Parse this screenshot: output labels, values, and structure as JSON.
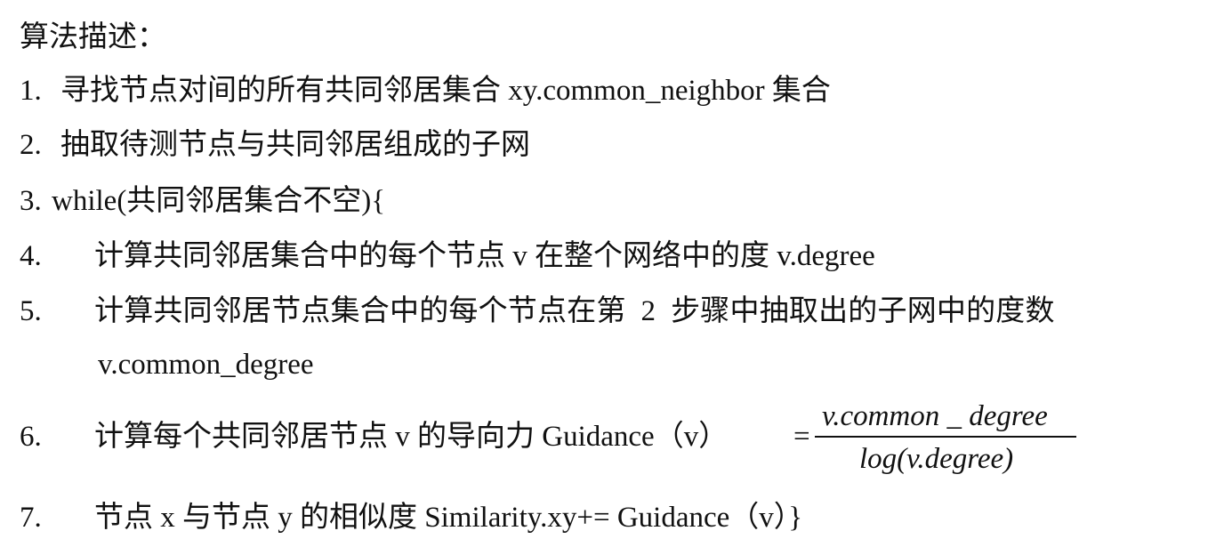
{
  "title": "算法描述：",
  "steps": [
    {
      "num": "1.",
      "text": "寻找节点对间的所有共同邻居集合 xy.common_neighbor 集合"
    },
    {
      "num": "2.",
      "text": "抽取待测节点与共同邻居组成的子网"
    },
    {
      "num": "3.",
      "text": "while(共同邻居集合不空){"
    },
    {
      "num": "4.",
      "text": "计算共同邻居集合中的每个节点 v 在整个网络中的度 v.degree"
    },
    {
      "num": "5.",
      "text": "计算共同邻居节点集合中的每个节点在第  2  步骤中抽取出的子网中的度数",
      "text2": "v.common_degree"
    },
    {
      "num": "6.",
      "text": "计算每个共同邻居节点 v 的导向力 Guidance（v）",
      "eq": "=",
      "numerator": "v.common _ degree",
      "denominator": "log(v.degree)"
    },
    {
      "num": "7.",
      "text": "节点 x 与节点 y 的相似度 Similarity.xy+= Guidance（v）}"
    }
  ]
}
